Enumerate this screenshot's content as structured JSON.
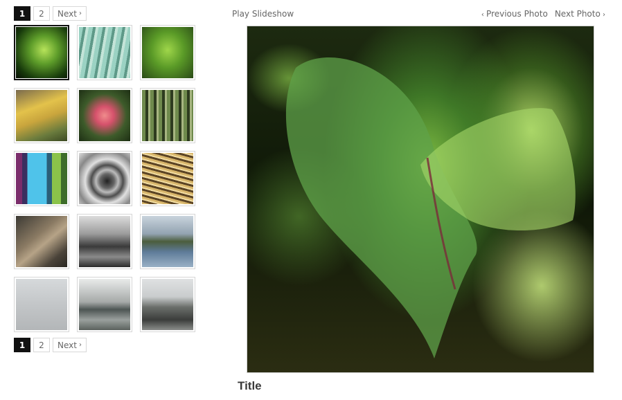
{
  "pagination_top": {
    "pages": [
      "1",
      "2"
    ],
    "active": "1",
    "next_label": "Next"
  },
  "pagination_bottom": {
    "pages": [
      "1",
      "2"
    ],
    "active": "1",
    "next_label": "Next"
  },
  "slideshow": {
    "play_label": "Play Slideshow"
  },
  "photo_nav": {
    "previous_label": "Previous Photo",
    "next_label": "Next Photo"
  },
  "photo": {
    "title": "Title"
  },
  "thumbnails": [
    {
      "subject": "green leaf closeup",
      "selected": true
    },
    {
      "subject": "striped leaf with water droplets",
      "selected": false
    },
    {
      "subject": "large green leaf",
      "selected": false
    },
    {
      "subject": "yellow pods with lizard",
      "selected": false
    },
    {
      "subject": "pink flower",
      "selected": false
    },
    {
      "subject": "bamboo grove",
      "selected": false
    },
    {
      "subject": "colored vertical stripes",
      "selected": false
    },
    {
      "subject": "camera lens",
      "selected": false
    },
    {
      "subject": "golden spiral texture",
      "selected": false
    },
    {
      "subject": "knotted rope",
      "selected": false
    },
    {
      "subject": "city at night black and white",
      "selected": false
    },
    {
      "subject": "coastal town",
      "selected": false
    },
    {
      "subject": "foggy sea with boat",
      "selected": false
    },
    {
      "subject": "sea rocks",
      "selected": false
    },
    {
      "subject": "coastal road",
      "selected": false
    }
  ],
  "colors": {
    "accent": "#111111",
    "link": "#666666",
    "title": "#3a3a3a"
  }
}
